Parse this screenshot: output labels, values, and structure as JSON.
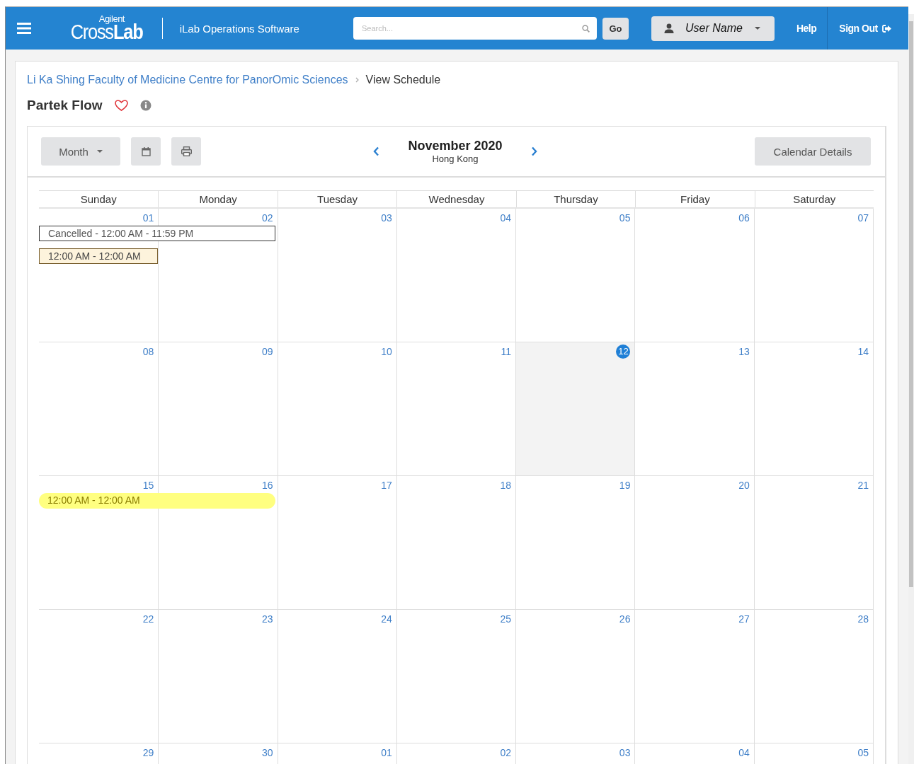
{
  "header": {
    "logo": {
      "top": "Agilent",
      "light": "Cross",
      "bold": "Lab"
    },
    "app_name": "iLab Operations Software",
    "search": {
      "placeholder": "Search..."
    },
    "go": "Go",
    "user": "User Name",
    "help": "Help",
    "sign_out": "Sign Out"
  },
  "breadcrumb": [
    {
      "text": "Li Ka Shing Faculty of Medicine Centre for PanorOmic Sciences",
      "kind": "link"
    },
    {
      "text": "View Schedule",
      "kind": "current"
    }
  ],
  "title": "Partek Flow",
  "favorited": false,
  "toolbar": {
    "view": "Month",
    "month": "November 2020",
    "timezone": "Hong Kong",
    "details": "Calendar Details"
  },
  "weekdays": [
    "Sunday",
    "Monday",
    "Tuesday",
    "Wednesday",
    "Thursday",
    "Friday",
    "Saturday"
  ],
  "weeks": [
    {
      "days": [
        {
          "label": "01",
          "today": false,
          "events": [
            {
              "text": "Cancelled - 12:00 AM - 11:59 PM",
              "kind": "cancelled",
              "continues": true
            },
            {
              "text": "12:00 AM - 12:00 AM",
              "kind": "booking",
              "continues": false
            }
          ]
        },
        {
          "label": "02",
          "today": false
        },
        {
          "label": "03",
          "today": false
        },
        {
          "label": "04",
          "today": false
        },
        {
          "label": "05",
          "today": false
        },
        {
          "label": "06",
          "today": false
        },
        {
          "label": "07",
          "today": false
        }
      ]
    },
    {
      "days": [
        {
          "label": "08",
          "today": false
        },
        {
          "label": "09",
          "today": false
        },
        {
          "label": "10",
          "today": false
        },
        {
          "label": "11",
          "today": false
        },
        {
          "label": "12",
          "today": true
        },
        {
          "label": "13",
          "today": false
        },
        {
          "label": "14",
          "today": false
        }
      ]
    },
    {
      "days": [
        {
          "label": "15",
          "today": false,
          "events": [
            {
              "text": "12:00 AM - 12:00 AM",
              "kind": "highlight",
              "continues": true
            }
          ]
        },
        {
          "label": "16",
          "today": false
        },
        {
          "label": "17",
          "today": false
        },
        {
          "label": "18",
          "today": false
        },
        {
          "label": "19",
          "today": false
        },
        {
          "label": "20",
          "today": false
        },
        {
          "label": "21",
          "today": false
        }
      ]
    },
    {
      "days": [
        {
          "label": "22",
          "today": false
        },
        {
          "label": "23",
          "today": false
        },
        {
          "label": "24",
          "today": false
        },
        {
          "label": "25",
          "today": false
        },
        {
          "label": "26",
          "today": false
        },
        {
          "label": "27",
          "today": false
        },
        {
          "label": "28",
          "today": false
        }
      ]
    },
    {
      "days": [
        {
          "label": "29",
          "today": false
        },
        {
          "label": "30",
          "today": false
        },
        {
          "label": "01",
          "today": false
        },
        {
          "label": "02",
          "today": false
        },
        {
          "label": "03",
          "today": false
        },
        {
          "label": "04",
          "today": false
        },
        {
          "label": "05",
          "today": false
        }
      ]
    }
  ]
}
